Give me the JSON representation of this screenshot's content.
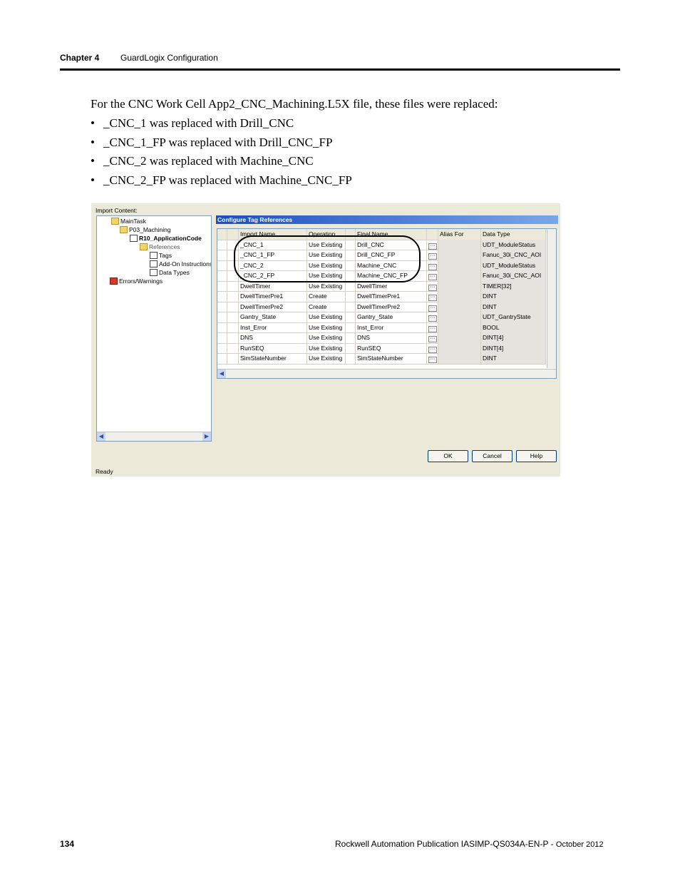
{
  "header": {
    "chapter": "Chapter 4",
    "title": "GuardLogix Configuration"
  },
  "intro": "For the CNC Work Cell App2_CNC_Machining.L5X file, these files were replaced:",
  "bullets": [
    "_CNC_1 was replaced with Drill_CNC",
    "_CNC_1_FP was replaced with Drill_CNC_FP",
    "_CNC_2 was replaced with Machine_CNC",
    "_CNC_2_FP was replaced with Machine_CNC_FP"
  ],
  "dialog": {
    "import_content_label": "Import Content:",
    "tree": [
      "MainTask",
      "P03_Machining",
      "R10_ApplicationCode",
      "References",
      "Tags",
      "Add-On Instructions",
      "Data Types",
      "Errors/Warnings"
    ],
    "configure_title": "Configure Tag References",
    "columns": [
      "Import Name",
      "Operation",
      "Final Name",
      "Alias For",
      "Data Type"
    ],
    "rows": [
      {
        "import": "_CNC_1",
        "op": "Use Existing",
        "final": "Drill_CNC",
        "type": "UDT_ModuleStatus"
      },
      {
        "import": "_CNC_1_FP",
        "op": "Use Existing",
        "final": "Drill_CNC_FP",
        "type": "Fanuc_30i_CNC_AOI"
      },
      {
        "import": "_CNC_2",
        "op": "Use Existing",
        "final": "Machine_CNC",
        "type": "UDT_ModuleStatus"
      },
      {
        "import": "_CNC_2_FP",
        "op": "Use Existing",
        "final": "Machine_CNC_FP",
        "type": "Fanuc_30i_CNC_AOI"
      },
      {
        "import": "DwellTimer",
        "op": "Use Existing",
        "final": "DwellTimer",
        "type": "TIMER[32]"
      },
      {
        "import": "DwellTimerPre1",
        "op": "Create",
        "final": "DwellTimerPre1",
        "type": "DINT"
      },
      {
        "import": "DwellTimerPre2",
        "op": "Create",
        "final": "DwellTimerPre2",
        "type": "DINT"
      },
      {
        "import": "Gantry_State",
        "op": "Use Existing",
        "final": "Gantry_State",
        "type": "UDT_GantryState"
      },
      {
        "import": "Inst_Error",
        "op": "Use Existing",
        "final": "Inst_Error",
        "type": "BOOL"
      },
      {
        "import": "DNS",
        "op": "Use Existing",
        "final": "DNS",
        "type": "DINT[4]"
      },
      {
        "import": "RunSEQ",
        "op": "Use Existing",
        "final": "RunSEQ",
        "type": "DINT[4]"
      },
      {
        "import": "SimStateNumber",
        "op": "Use Existing",
        "final": "SimStateNumber",
        "type": "DINT"
      }
    ],
    "buttons": {
      "ok": "OK",
      "cancel": "Cancel",
      "help": "Help"
    },
    "status": "Ready"
  },
  "footer": {
    "page": "134",
    "publication": "Rockwell Automation Publication IASIMP-QS034A-EN-P - ",
    "date": "October 2012"
  }
}
